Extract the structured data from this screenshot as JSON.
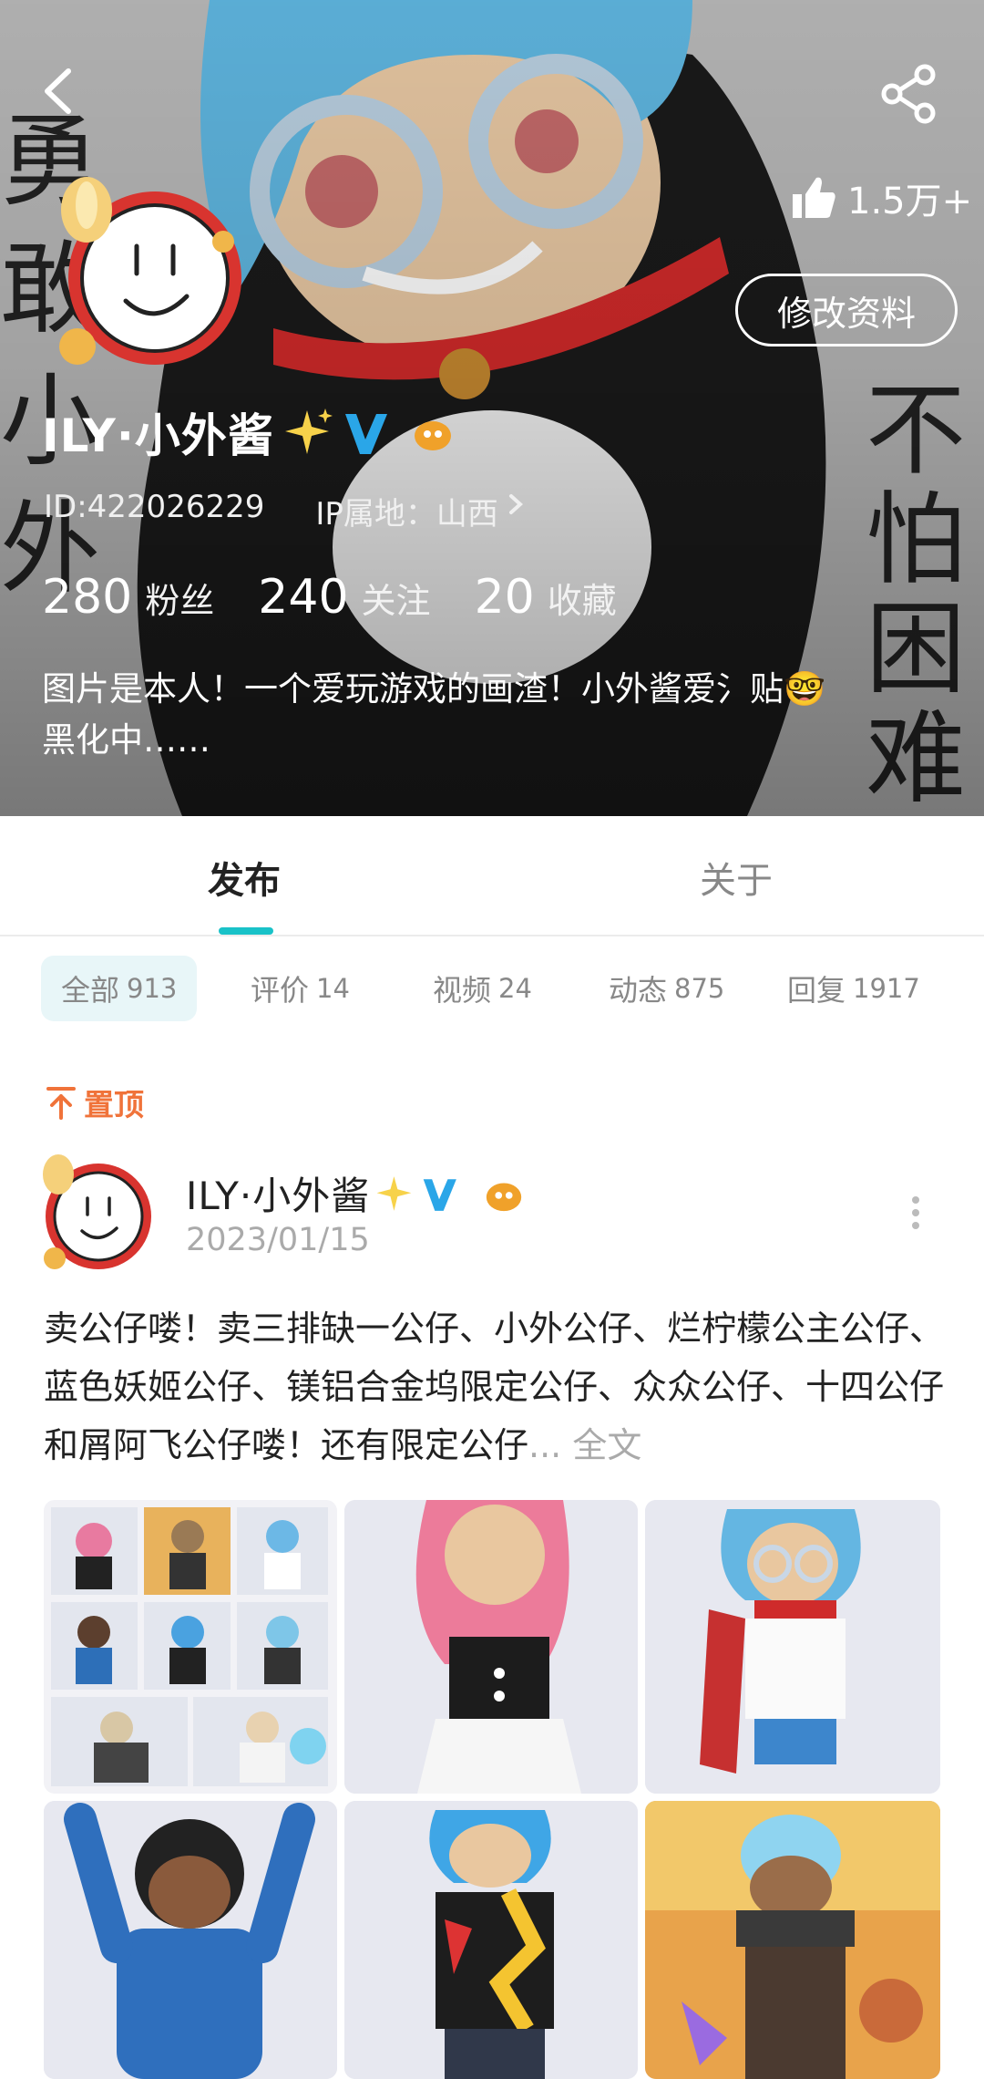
{
  "header": {
    "likes": "1.5万+",
    "edit_label": "修改资料",
    "name": "ILY·小外酱",
    "id_text": "ID:422026229",
    "ip_text": "IP属地：山西",
    "stats": [
      {
        "num": "280",
        "label": "粉丝"
      },
      {
        "num": "240",
        "label": "关注"
      },
      {
        "num": "20",
        "label": "收藏"
      }
    ],
    "bio_line1": "图片是本人！一个爱玩游戏的画渣！小外酱爱氵贴🤓",
    "bio_line2": "黑化中……",
    "bg_text_left": "勇敢小外",
    "bg_text_right": "不怕困难"
  },
  "tabs": [
    "发布",
    "关于"
  ],
  "chips": [
    {
      "label": "全部",
      "count": "913"
    },
    {
      "label": "评价",
      "count": "14"
    },
    {
      "label": "视频",
      "count": "24"
    },
    {
      "label": "动态",
      "count": "875"
    },
    {
      "label": "回复",
      "count": "1917"
    }
  ],
  "post": {
    "pinned_label": "置顶",
    "author": "ILY·小外酱",
    "date": "2023/01/15",
    "text": "卖公仔喽！卖三排缺一公仔、小外公仔、烂柠檬公主公仔、蓝色妖姬公仔、镁铝合金坞限定公仔、众众公仔、十四公仔和屑阿飞公仔喽！还有限定公仔",
    "fulltext_label": "... 全文"
  },
  "colors": {
    "accent": "#19c2c8",
    "pinned": "#f0733a",
    "verified": "#2aa6e8"
  }
}
